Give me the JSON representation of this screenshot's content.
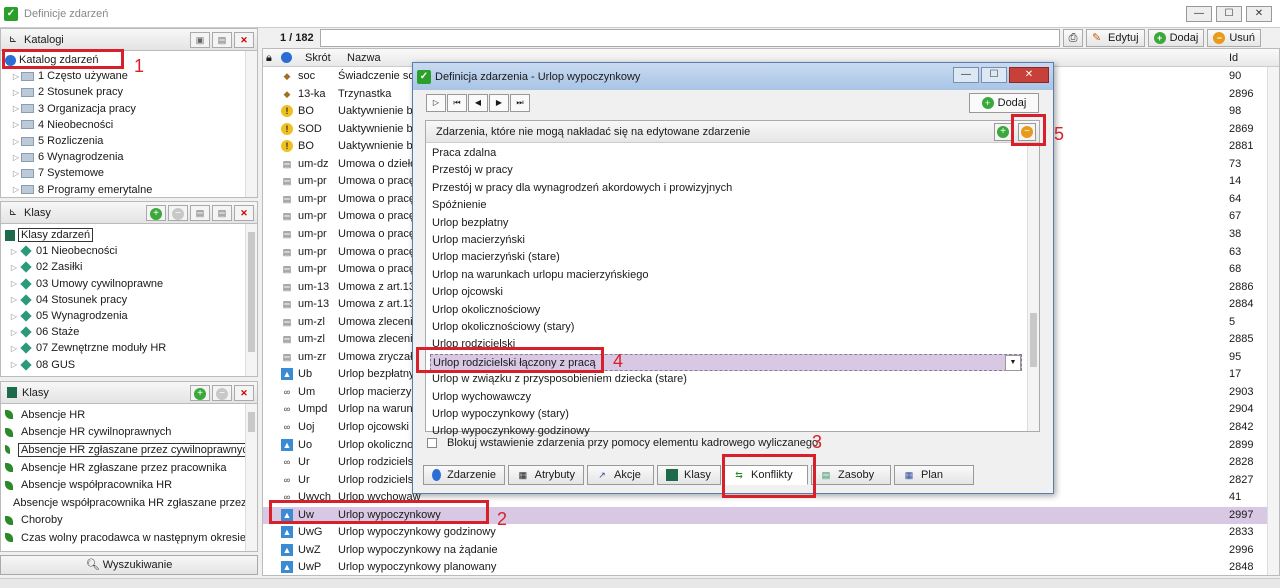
{
  "window": {
    "title": "Definicje zdarzeń"
  },
  "katalogi": {
    "title": "Katalogi",
    "root": "Katalog zdarzeń",
    "items": [
      "1 Często używane",
      "2 Stosunek pracy",
      "3 Organizacja pracy",
      "4 Nieobecności",
      "5 Rozliczenia",
      "6 Wynagrodzenia",
      "7 Systemowe",
      "8 Programy emerytalne"
    ]
  },
  "klasy_top": {
    "title": "Klasy",
    "root": "Klasy zdarzeń",
    "items": [
      "01 Nieobecności",
      "02 Zasiłki",
      "03 Umowy cywilnoprawne",
      "04 Stosunek pracy",
      "05 Wynagrodzenia",
      "06 Staże",
      "07 Zewnętrzne moduły HR",
      "08 GUS"
    ]
  },
  "klasy_bottom": {
    "title": "Klasy",
    "items": [
      "Absencje HR",
      "Absencje HR cywilnoprawnych",
      "Absencje HR zgłaszane przez cywilnoprawnych",
      "Absencje HR zgłaszane przez pracownika",
      "Absencje współpracownika HR",
      "Absencje współpracownika HR zgłaszane przez ...",
      "Choroby",
      "Czas wolny pracodawca w następnym okresie"
    ]
  },
  "search_button": "Wyszukiwanie",
  "toolbar": {
    "counter": "1 / 182",
    "edit": "Edytuj",
    "add": "Dodaj",
    "delete": "Usuń"
  },
  "list": {
    "col_code": "Skrót",
    "col_name": "Nazwa",
    "col_id": "Id",
    "rows": [
      {
        "icon": "tag",
        "code": "soc",
        "name": "Świadczenie soc",
        "id": "90"
      },
      {
        "icon": "tag",
        "code": "13-ka",
        "name": "Trzynastka",
        "id": "2896"
      },
      {
        "icon": "warn",
        "code": "BO",
        "name": "Uaktywnienie bil",
        "id": "98"
      },
      {
        "icon": "warn",
        "code": "SOD",
        "name": "Uaktywnienie bil",
        "id": "2869"
      },
      {
        "icon": "warn",
        "code": "BO",
        "name": "Uaktywnienie bil",
        "id": "2881"
      },
      {
        "icon": "doc",
        "code": "um-dz",
        "name": "Umowa o dzieło",
        "id": "73"
      },
      {
        "icon": "doc",
        "code": "um-pr",
        "name": "Umowa o pracę",
        "id": "14"
      },
      {
        "icon": "doc",
        "code": "um-pr",
        "name": "Umowa o pracę",
        "id": "64"
      },
      {
        "icon": "doc",
        "code": "um-pr",
        "name": "Umowa o pracę",
        "id": "67"
      },
      {
        "icon": "doc",
        "code": "um-pr",
        "name": "Umowa o pracę",
        "id": "38"
      },
      {
        "icon": "doc",
        "code": "um-pr",
        "name": "Umowa o pracę",
        "id": "63"
      },
      {
        "icon": "doc",
        "code": "um-pr",
        "name": "Umowa o pracę",
        "id": "68"
      },
      {
        "icon": "doc",
        "code": "um-13",
        "name": "Umowa z art.13",
        "id": "2886"
      },
      {
        "icon": "doc",
        "code": "um-13",
        "name": "Umowa z art.13",
        "id": "2884"
      },
      {
        "icon": "doc",
        "code": "um-zl",
        "name": "Umowa zlecenia",
        "id": "5"
      },
      {
        "icon": "doc",
        "code": "um-zl",
        "name": "Umowa zlecenia",
        "id": "2885"
      },
      {
        "icon": "doc",
        "code": "um-zr",
        "name": "Umowa zryczałt",
        "id": "95"
      },
      {
        "icon": "img",
        "code": "Ub",
        "name": "Urlop bezpłatny",
        "id": "17"
      },
      {
        "icon": "sym",
        "code": "Um",
        "name": "Urlop macierzyń",
        "id": "2903"
      },
      {
        "icon": "sym",
        "code": "Umpd",
        "name": "Urlop na warunk",
        "id": "2904"
      },
      {
        "icon": "sym",
        "code": "Uoj",
        "name": "Urlop ojcowski",
        "id": "2842"
      },
      {
        "icon": "img",
        "code": "Uo",
        "name": "Urlop okolicznoś",
        "id": "2899"
      },
      {
        "icon": "sym",
        "code": "Ur",
        "name": "Urlop rodzicielsk",
        "id": "2828"
      },
      {
        "icon": "sym",
        "code": "Ur",
        "name": "Urlop rodzicielsk",
        "id": "2827"
      },
      {
        "icon": "sym",
        "code": "Uwych",
        "name": "Urlop wychowaw",
        "id": "41"
      },
      {
        "icon": "img",
        "code": "Uw",
        "name": "Urlop wypoczynkowy",
        "id": "2997"
      },
      {
        "icon": "img",
        "code": "UwG",
        "name": "Urlop wypoczynkowy godzinowy",
        "id": "2833"
      },
      {
        "icon": "img",
        "code": "UwZ",
        "name": "Urlop wypoczynkowy na żądanie",
        "id": "2996"
      },
      {
        "icon": "img",
        "code": "UwP",
        "name": "Urlop wypoczynkowy planowany",
        "id": "2848"
      }
    ]
  },
  "dialog": {
    "title": "Definicja zdarzenia - Urlop wypoczynkowy",
    "add": "Dodaj",
    "conflicts_header": "Zdarzenia, które nie mogą nakładać się na edytowane zdarzenie",
    "conflicts": [
      "Praca zdalna",
      "Przestój w pracy",
      "Przestój w pracy dla wynagrodzeń akordowych i prowizyjnych",
      "Spóźnienie",
      "Urlop bezpłatny",
      "Urlop macierzyński",
      "Urlop macierzyński (stare)",
      "Urlop na warunkach urlopu macierzyńskiego",
      "Urlop ojcowski",
      "Urlop okolicznościowy",
      "Urlop okolicznościowy (stary)",
      "Urlop rodzicielski",
      "Urlop rodzicielski łączony z pracą",
      "Urlop w związku z przysposobieniem dziecka (stare)",
      "Urlop wychowawczy",
      "Urlop wypoczynkowy (stary)",
      "Urlop wypoczynkowy godzinowy"
    ],
    "checkbox_label": "Blokuj wstawienie zdarzenia przy pomocy elementu kadrowego wyliczanego",
    "tabs": [
      "Zdarzenie",
      "Atrybuty",
      "Akcje",
      "Klasy",
      "Konflikty",
      "Zasoby",
      "Plan"
    ]
  },
  "annotations": [
    "1",
    "2",
    "3",
    "4",
    "5"
  ],
  "colors": {
    "annotation": "#d8202a",
    "selection": "#d8c8e4",
    "accent_green": "#3aa83a"
  }
}
